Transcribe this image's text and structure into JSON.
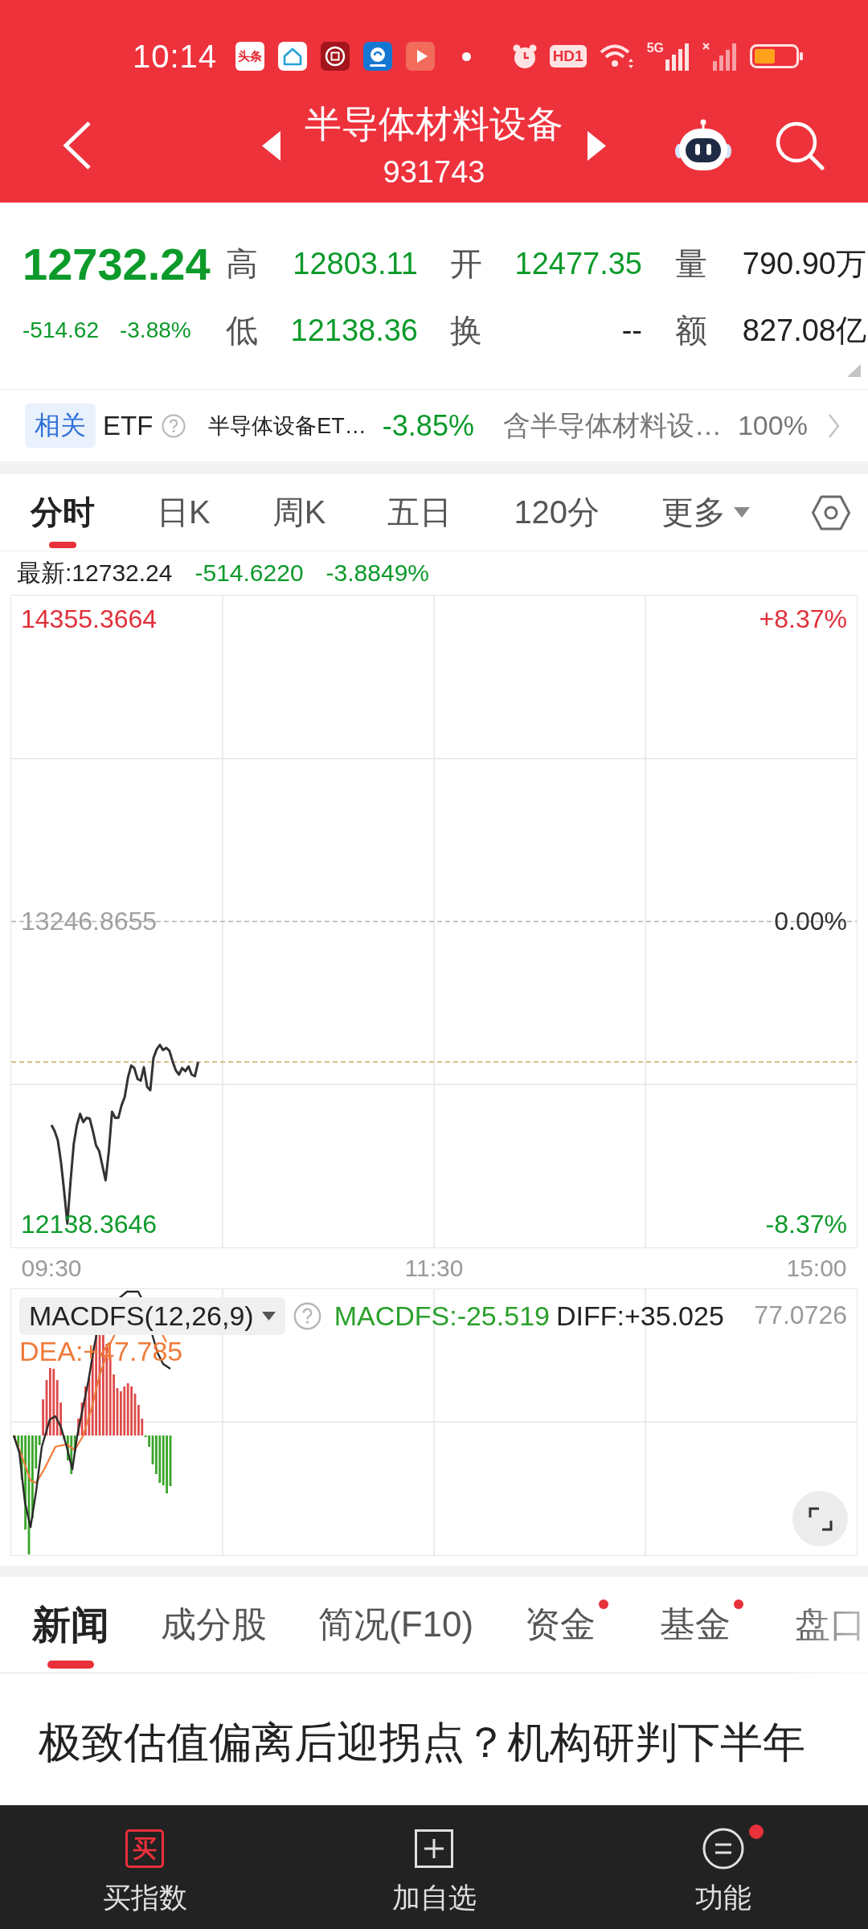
{
  "status_bar": {
    "time": "10:14",
    "notification_icons": [
      {
        "kind": "text",
        "label": "头条"
      },
      {
        "kind": "house"
      },
      {
        "kind": "coin"
      },
      {
        "kind": "swirl"
      },
      {
        "kind": "play"
      }
    ],
    "hd_label": "HD1",
    "network_label": "5G"
  },
  "header": {
    "title": "半导体材料设备",
    "code": "931743"
  },
  "quote": {
    "price": "12732.24",
    "change": "-514.62",
    "change_pct": "-3.88%",
    "falling": true,
    "fields": [
      {
        "label": "高",
        "value": "12803.11",
        "color": "#0c9a2a"
      },
      {
        "label": "开",
        "value": "12477.35",
        "color": "#0c9a2a"
      },
      {
        "label": "量",
        "value": "790.90万",
        "color": "#222222"
      },
      {
        "label": "低",
        "value": "12138.36",
        "color": "#0c9a2a"
      },
      {
        "label": "换",
        "value": "--",
        "color": "#222222"
      },
      {
        "label": "额",
        "value": "827.08亿",
        "color": "#222222"
      }
    ]
  },
  "related_etf": {
    "tag": "相关",
    "label": "ETF",
    "fund_name": "半导体设备ET…",
    "change": "-3.85%",
    "falling": true,
    "holding_label": "含半导体材料设…",
    "holding_pct": "100%"
  },
  "chart_tabs": [
    {
      "label": "分时",
      "selected": true,
      "kind": "tab"
    },
    {
      "label": "日K",
      "selected": false,
      "kind": "tab"
    },
    {
      "label": "周K",
      "selected": false,
      "kind": "tab"
    },
    {
      "label": "五日",
      "selected": false,
      "kind": "tab"
    },
    {
      "label": "120分",
      "selected": false,
      "kind": "tab"
    },
    {
      "label": "更多",
      "selected": false,
      "kind": "dropdown"
    }
  ],
  "latest": {
    "label": "最新:12732.24",
    "change": "-514.6220",
    "change_pct": "-3.8849%",
    "falling": true
  },
  "intraday_chart": {
    "chart_data": {
      "type": "line",
      "categories": [
        "09:30",
        null,
        null,
        null,
        null,
        null,
        null,
        null,
        null,
        null,
        null,
        null,
        null,
        null,
        null,
        null,
        null,
        null,
        null,
        null,
        null,
        null,
        null,
        null,
        null,
        null,
        null,
        null,
        null,
        null,
        null,
        null,
        null,
        null,
        null,
        null,
        null,
        null,
        null,
        null,
        null,
        null,
        null,
        null,
        null,
        null,
        null,
        null,
        null,
        null,
        null,
        null,
        null,
        null,
        null,
        null,
        null,
        null,
        null,
        null,
        null,
        null,
        null,
        null,
        null,
        null,
        null,
        null,
        null,
        null,
        null,
        null,
        null,
        null,
        null,
        null,
        null,
        null,
        null,
        null,
        null,
        null,
        null,
        null,
        null,
        null,
        null,
        null,
        null,
        null,
        null,
        null,
        null,
        null,
        null,
        null,
        null,
        null,
        null,
        null,
        null,
        null,
        null,
        null,
        null,
        null,
        null,
        null,
        null,
        null,
        null,
        null,
        null,
        null,
        null,
        null,
        null,
        null,
        null,
        null,
        "11:30",
        null,
        null,
        null,
        null,
        null,
        null,
        null,
        null,
        null,
        null,
        null,
        null,
        null,
        null,
        null,
        null,
        null,
        null,
        null,
        null,
        null,
        null,
        null,
        null,
        null,
        null,
        null,
        null,
        null,
        null,
        null,
        null,
        null,
        null,
        null,
        null,
        null,
        null,
        null,
        null,
        null,
        null,
        null,
        null,
        null,
        null,
        null,
        null,
        null,
        null,
        null,
        null,
        null,
        null,
        null,
        null,
        null,
        null,
        null,
        null,
        null,
        null,
        null,
        null,
        null,
        null,
        null,
        null,
        null,
        null,
        null,
        null,
        null,
        null,
        null,
        null,
        null,
        null,
        null,
        null,
        null,
        null,
        null,
        null,
        null,
        null,
        null,
        null,
        null,
        null,
        null,
        null,
        null,
        null,
        null,
        null,
        null,
        null,
        null,
        null,
        null,
        null,
        null,
        null,
        null,
        null,
        null,
        null,
        null,
        null,
        null,
        null,
        null,
        null,
        null,
        null,
        null,
        null,
        null,
        "15:00"
      ],
      "values": [
        12501,
        12479,
        12446,
        12365,
        12256,
        12140,
        12296,
        12433,
        12501,
        12542,
        12512,
        12528,
        12525,
        12479,
        12427,
        12405,
        12351,
        12299,
        12405,
        12550,
        12528,
        12528,
        12574,
        12604,
        12675,
        12719,
        12710,
        12670,
        12664,
        12713,
        12642,
        12629,
        12746,
        12778,
        12795,
        12776,
        12784,
        12773,
        12735,
        12702,
        12686,
        12710,
        12699,
        12716,
        12686,
        12680,
        12732,
        null,
        null,
        null,
        null,
        null,
        null,
        null,
        null,
        null,
        null,
        null,
        null,
        null,
        null,
        null,
        null,
        null,
        null,
        null,
        null,
        null,
        null,
        null,
        null,
        null,
        null,
        null,
        null,
        null,
        null,
        null,
        null,
        null,
        null,
        null,
        null,
        null,
        null,
        null,
        null,
        null,
        null,
        null,
        null,
        null,
        null,
        null,
        null,
        null,
        null,
        null,
        null,
        null,
        null,
        null,
        null,
        null,
        null,
        null,
        null,
        null,
        null,
        null,
        null,
        null,
        null,
        null,
        null,
        null,
        null,
        null,
        null,
        null,
        null,
        null,
        null,
        null,
        null,
        null,
        null,
        null,
        null,
        null,
        null,
        null,
        null,
        null,
        null,
        null,
        null,
        null,
        null,
        null,
        null,
        null,
        null,
        null,
        null,
        null,
        null,
        null,
        null,
        null,
        null,
        null,
        null,
        null,
        null,
        null,
        null,
        null,
        null,
        null,
        null,
        null,
        null,
        null,
        null,
        null,
        null,
        null,
        null,
        null,
        null,
        null,
        null,
        null,
        null,
        null,
        null,
        null,
        null,
        null,
        null,
        null,
        null,
        null,
        null,
        null,
        null,
        null,
        null,
        null,
        null,
        null,
        null,
        null,
        null,
        null,
        null,
        null,
        null,
        null,
        null,
        null,
        null,
        null,
        null,
        null,
        null,
        null,
        null,
        null,
        null,
        null,
        null,
        null,
        null,
        null,
        null,
        null,
        null,
        null,
        null,
        null,
        null,
        null,
        null,
        null,
        null,
        null,
        null,
        null,
        null,
        null,
        null,
        null,
        null,
        null,
        null,
        null,
        null,
        null,
        null
      ],
      "ylim": [
        12052.98,
        14440.75
      ],
      "yticks": [
        {
          "value": 12138.3646,
          "label": "12138.3646"
        },
        {
          "value": 13246.8655,
          "label": "13246.8655"
        },
        {
          "value": 14355.3664,
          "label": "14355.3664"
        }
      ],
      "ref_lines": [
        {
          "axis": "y",
          "value": 13246.8655,
          "color": "#b0b0b0"
        },
        {
          "axis": "y",
          "value": 12732.24,
          "color": "#c9a86b"
        }
      ]
    },
    "percent_labels": [
      {
        "text": "+8.37%",
        "color": "#e0303a"
      },
      {
        "text": "0.00%",
        "color": "#333333"
      },
      {
        "text": "-8.37%",
        "color": "#0c9a2a"
      }
    ]
  },
  "macd": {
    "indicator": "MACDFS(12,26,9)",
    "macdfs": "MACDFS:-25.519",
    "diff": "DIFF:+35.025",
    "dea": "DEA:+47.785",
    "scale_max": "77.0726"
  },
  "news_tabs": [
    {
      "label": "新闻",
      "selected": true,
      "dot": false
    },
    {
      "label": "成分股",
      "selected": false,
      "dot": false
    },
    {
      "label": "简况(F10)",
      "selected": false,
      "dot": false
    },
    {
      "label": "资金",
      "selected": false,
      "dot": true
    },
    {
      "label": "基金",
      "selected": false,
      "dot": true
    },
    {
      "label": "盘口",
      "selected": false,
      "dot": false
    }
  ],
  "headline": "极致估值偏离后迎拐点？机构研判下半年",
  "bottom_nav": [
    {
      "kind": "buy",
      "label": "买指数",
      "icon_text": "买",
      "badge": false
    },
    {
      "kind": "add",
      "label": "加自选",
      "badge": false
    },
    {
      "kind": "menu",
      "label": "功能",
      "badge": true
    }
  ]
}
